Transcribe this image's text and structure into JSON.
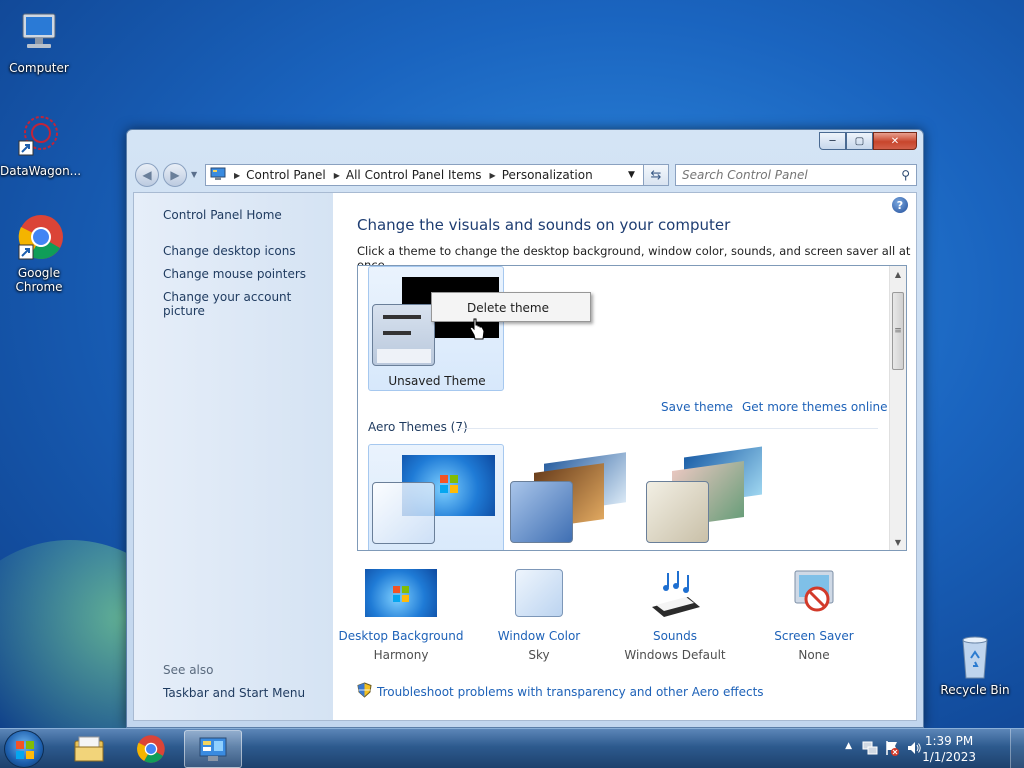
{
  "desktop": {
    "icons": {
      "computer": "Computer",
      "datawagon": "DataWagon...",
      "chrome": "Google Chrome",
      "recycle": "Recycle Bin"
    }
  },
  "window": {
    "caption": {
      "minimize": "─",
      "maximize": "▢",
      "close": "✕"
    },
    "address": {
      "segments": [
        "Control Panel",
        "All Control Panel Items",
        "Personalization"
      ]
    },
    "search": {
      "placeholder": "Search Control Panel"
    },
    "left_pane": {
      "links": [
        "Control Panel Home",
        "Change desktop icons",
        "Change mouse pointers",
        "Change your account picture"
      ],
      "see_also_label": "See also",
      "see_also": [
        "Taskbar and Start Menu"
      ]
    },
    "main": {
      "heading": "Change the visuals and sounds on your computer",
      "subtext": "Click a theme to change the desktop background, window color, sounds, and screen saver all at once.",
      "unsaved_theme": "Unsaved Theme",
      "save_theme": "Save theme",
      "get_more": "Get more themes online",
      "aero_group": "Aero Themes (7)",
      "bottom": [
        {
          "label": "Desktop Background",
          "value": "Harmony"
        },
        {
          "label": "Window Color",
          "value": "Sky"
        },
        {
          "label": "Sounds",
          "value": "Windows Default"
        },
        {
          "label": "Screen Saver",
          "value": "None"
        }
      ],
      "troubleshoot": "Troubleshoot problems with transparency and other Aero effects"
    },
    "context_menu": {
      "item": "Delete theme"
    }
  },
  "taskbar": {
    "clock_time": "1:39 PM",
    "clock_date": "1/1/2023"
  },
  "colors": {
    "link": "#1e62b8",
    "heading": "#1e3d72"
  }
}
